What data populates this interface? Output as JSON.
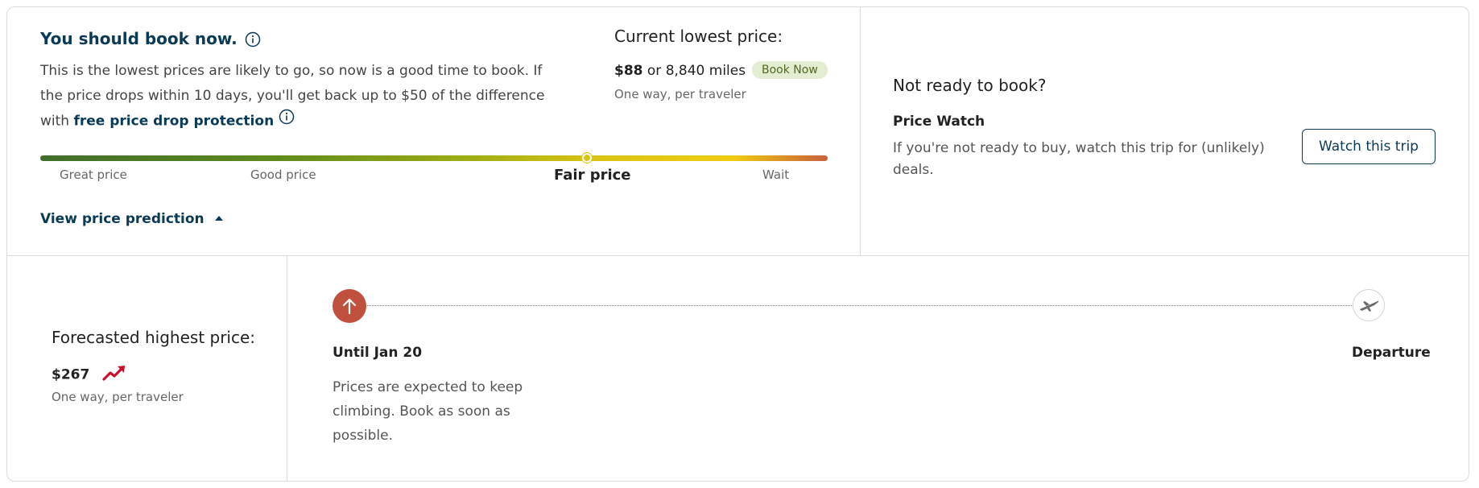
{
  "recommendation": {
    "title": "You should book now.",
    "description": "This is the lowest prices are likely to go, so now is a good time to book. If the price drops within 10 days, you'll get back up to $50 of the difference with",
    "protection_link": "free price drop protection"
  },
  "current_price": {
    "heading": "Current lowest price:",
    "price": "$88",
    "or_text": "or 8,840 miles",
    "badge": "Book Now",
    "subtext": "One way, per traveler"
  },
  "price_scale": {
    "labels": [
      "Great price",
      "Good price",
      "Fair price",
      "Wait"
    ],
    "current_label": "Fair price",
    "position_fraction": 0.695
  },
  "prediction_link": "View price prediction",
  "watch": {
    "heading": "Not ready to book?",
    "title": "Price Watch",
    "description": "If you're not ready to buy, watch this trip for (unlikely) deals.",
    "button": "Watch this trip"
  },
  "forecast": {
    "heading": "Forecasted highest price:",
    "price": "$267",
    "subtext": "One way, per traveler"
  },
  "timeline": {
    "start_label": "Until Jan 20",
    "start_description": "Prices are expected to keep climbing. Book as soon as possible.",
    "end_label": "Departure"
  },
  "colors": {
    "navy": "#0b3a56",
    "badge_bg": "#e4ecd2",
    "up_circle": "#c0513f",
    "trend_icon": "#c8102e"
  }
}
